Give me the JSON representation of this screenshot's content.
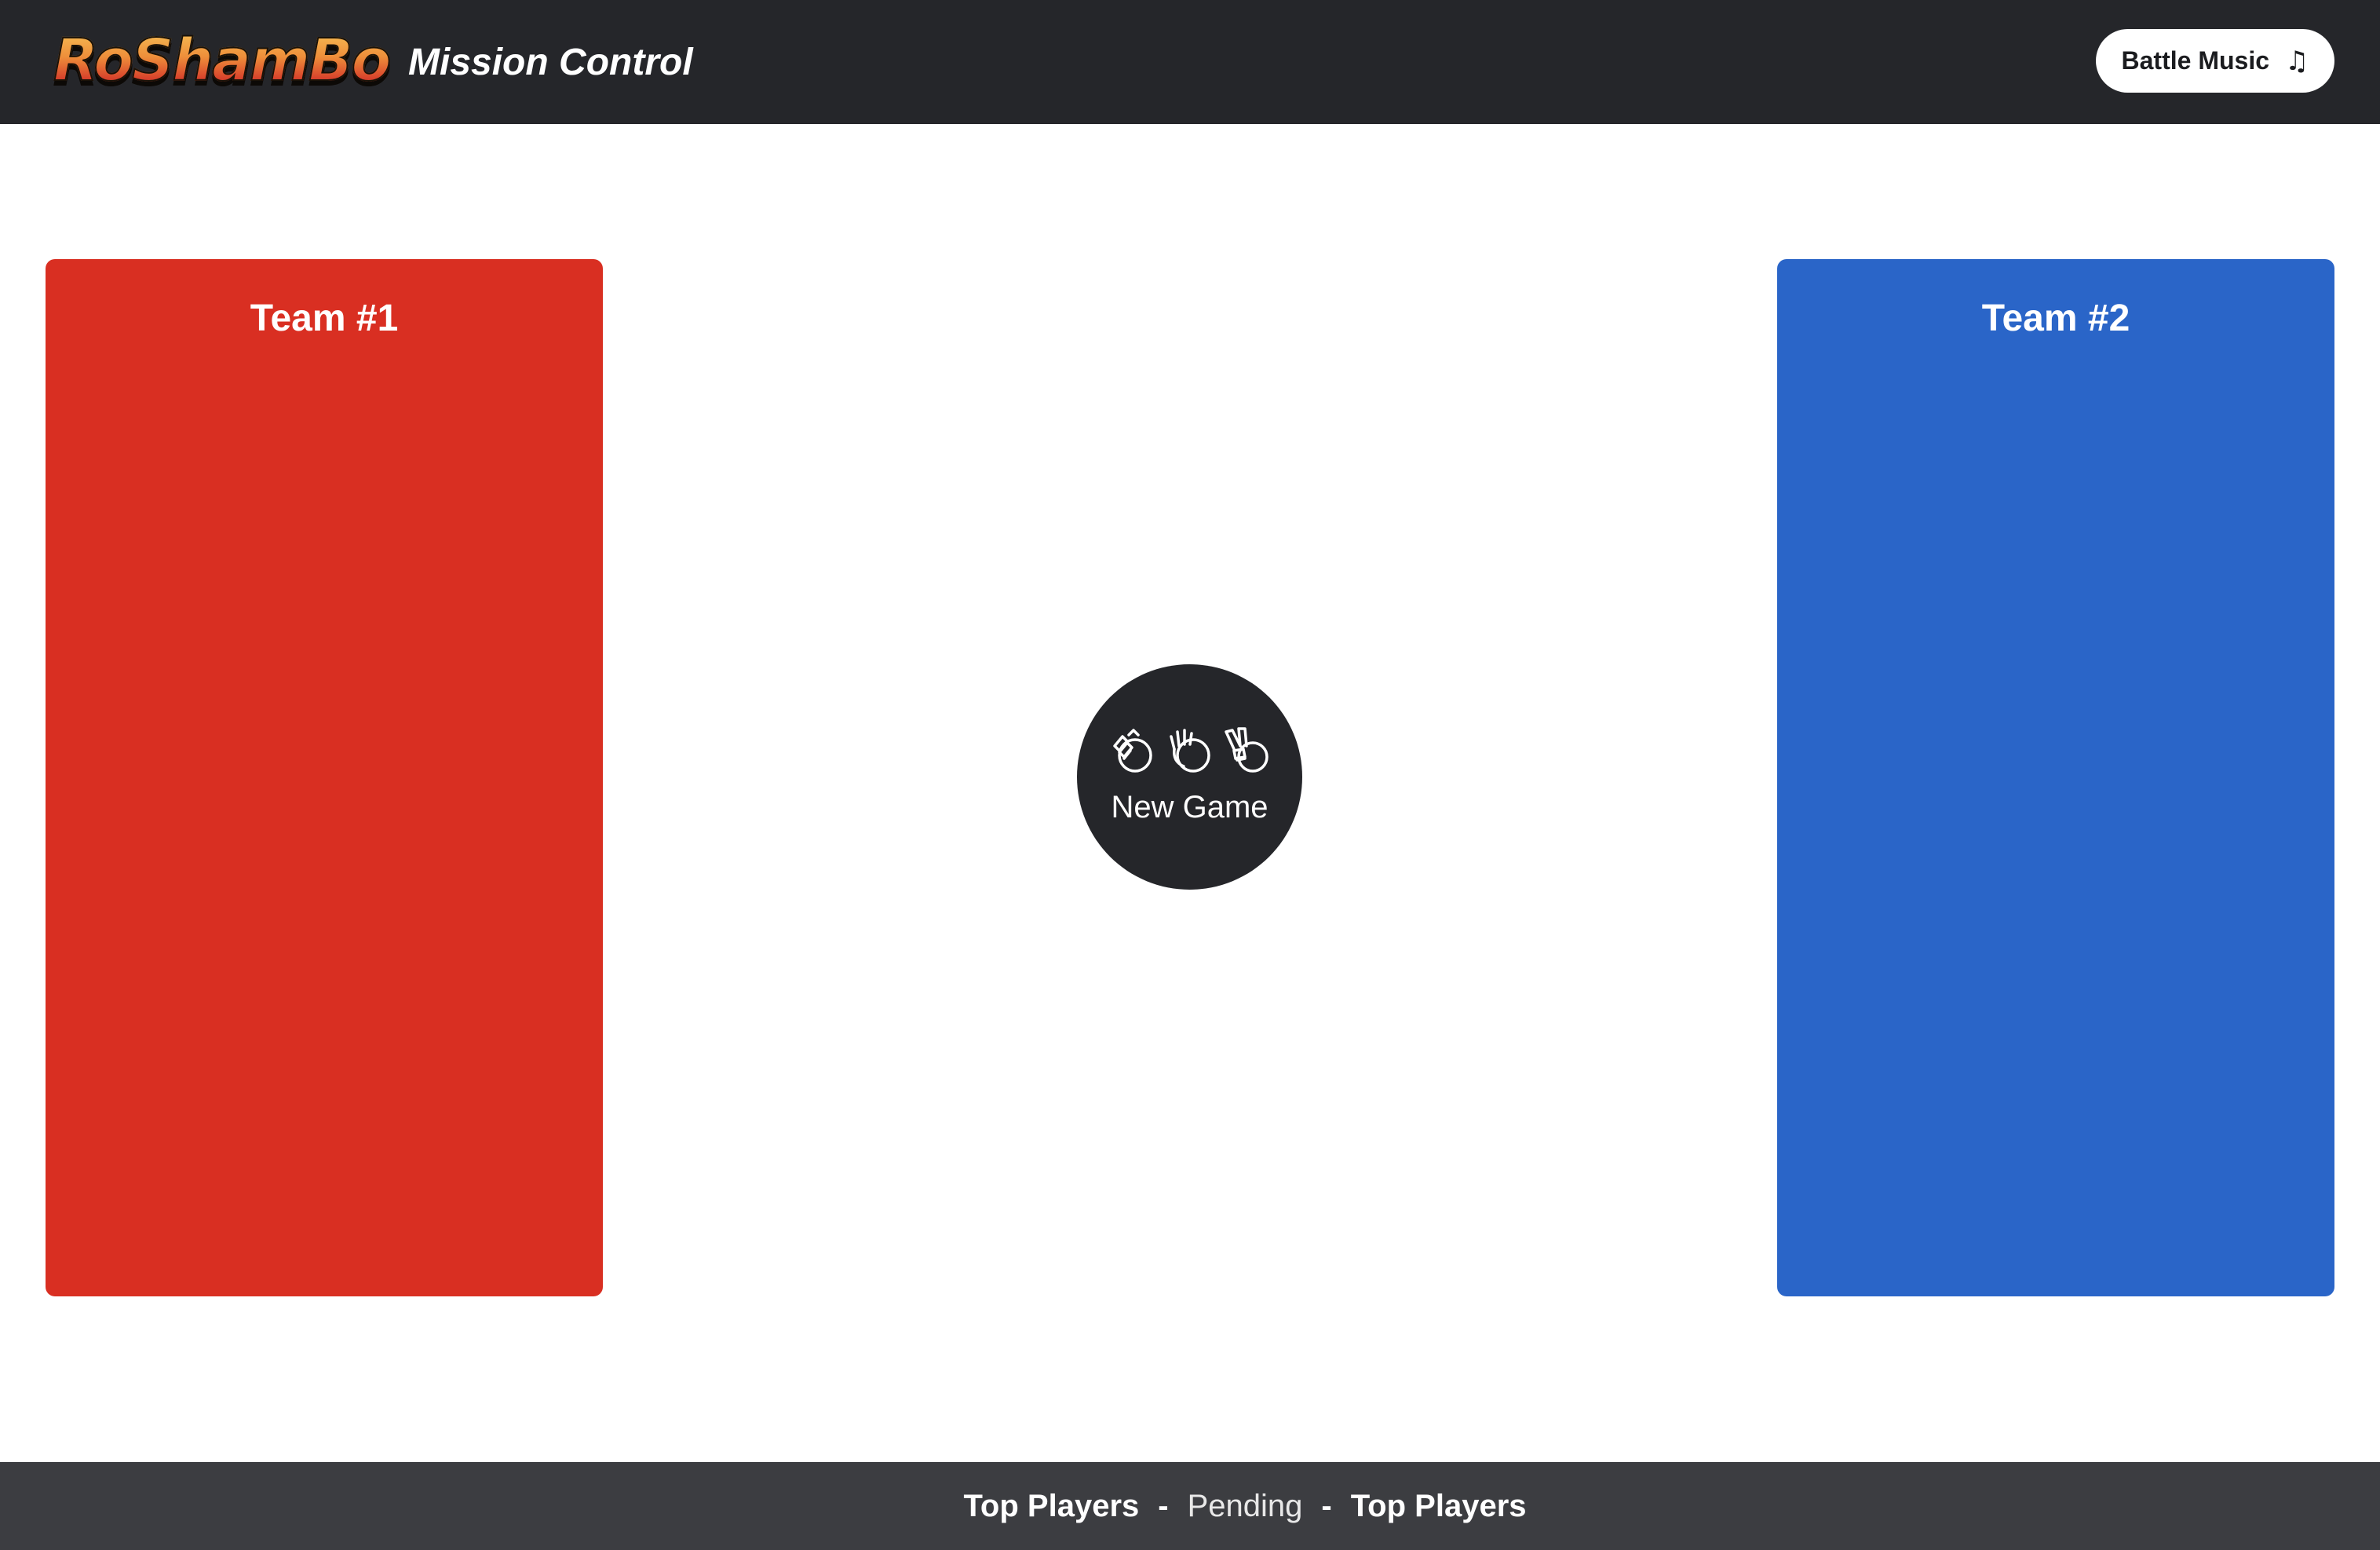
{
  "header": {
    "logo_text": "RoShamBo",
    "title": "Mission Control",
    "music_button": {
      "label": "Battle Music",
      "icon": "music-notes-icon",
      "icon_glyph": "♫"
    }
  },
  "teams": [
    {
      "title": "Team #1",
      "color": "#d92f22"
    },
    {
      "title": "Team #2",
      "color": "#2a65c8"
    }
  ],
  "new_game": {
    "label": "New Game",
    "icons": [
      "rock-hand-icon",
      "paper-hand-icon",
      "scissors-hand-icon"
    ]
  },
  "footer": {
    "left": "Top Players",
    "separator": "-",
    "status": "Pending",
    "right": "Top Players"
  },
  "colors": {
    "header_bg": "#25262a",
    "footer_bg": "#3c3d41",
    "team1": "#d92f22",
    "team2": "#2a65c8"
  }
}
